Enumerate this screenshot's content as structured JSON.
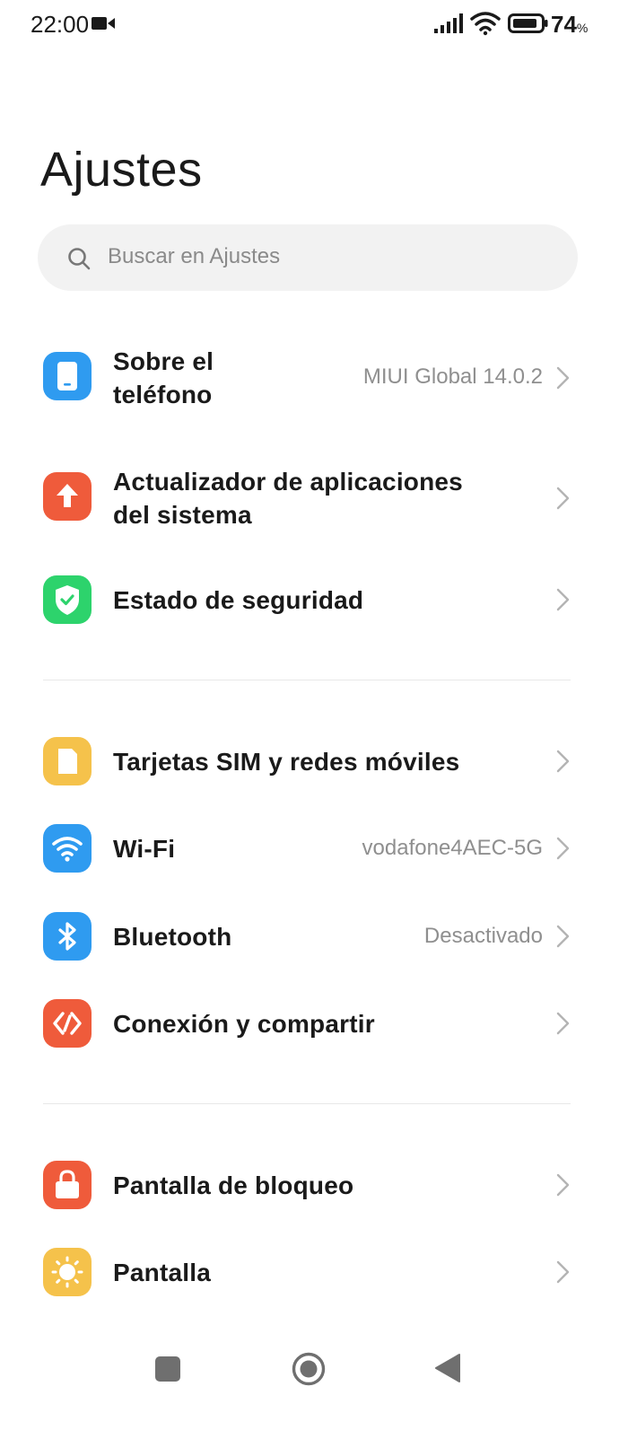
{
  "status_bar": {
    "time": "22:00",
    "battery": "74",
    "battery_unit": "%"
  },
  "header": {
    "title": "Ajustes"
  },
  "search": {
    "placeholder": "Buscar en Ajustes"
  },
  "settings": [
    {
      "label": "Sobre el\nteléfono",
      "value": "MIUI Global 14.0.2",
      "icon": "phone-icon",
      "icon_color": "#2f9bf0"
    },
    {
      "label": "Actualizador de aplicaciones\ndel sistema",
      "value": "",
      "icon": "arrow-up-icon",
      "icon_color": "#ef5b3b"
    },
    {
      "label": "Estado de seguridad",
      "value": "",
      "icon": "shield-check-icon",
      "icon_color": "#2dd36c"
    },
    {
      "label": "Tarjetas SIM y redes móviles",
      "value": "",
      "icon": "sim-card-icon",
      "icon_color": "#f5c24b"
    },
    {
      "label": "Wi-Fi",
      "value": "vodafone4AEC-5G",
      "icon": "wifi-icon",
      "icon_color": "#2f9bf0"
    },
    {
      "label": "Bluetooth",
      "value": "Desactivado",
      "icon": "bluetooth-icon",
      "icon_color": "#2f9bf0"
    },
    {
      "label": "Conexión y compartir",
      "value": "",
      "icon": "connection-share-icon",
      "icon_color": "#ef5b3b"
    },
    {
      "label": "Pantalla de bloqueo",
      "value": "",
      "icon": "lock-icon",
      "icon_color": "#ef5b3b"
    },
    {
      "label": "Pantalla",
      "value": "",
      "icon": "brightness-icon",
      "icon_color": "#f5c24b"
    }
  ],
  "nav_bar": {
    "recents_icon": "square-icon",
    "home_icon": "circle-icon",
    "back_icon": "triangle-back-icon"
  }
}
